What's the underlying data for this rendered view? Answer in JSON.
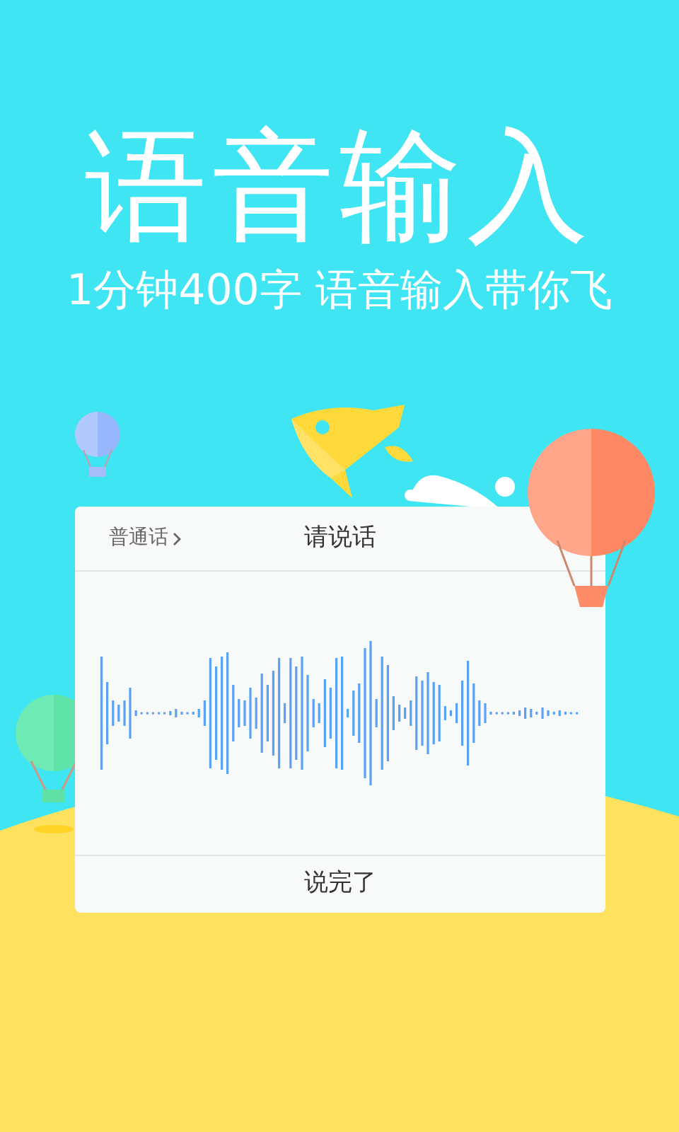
{
  "headline": "语音输入",
  "tagline": "1分钟400字 语音输入带你飞",
  "dialog": {
    "language": "普通话",
    "title": "请说话",
    "done_button": "说完了"
  }
}
